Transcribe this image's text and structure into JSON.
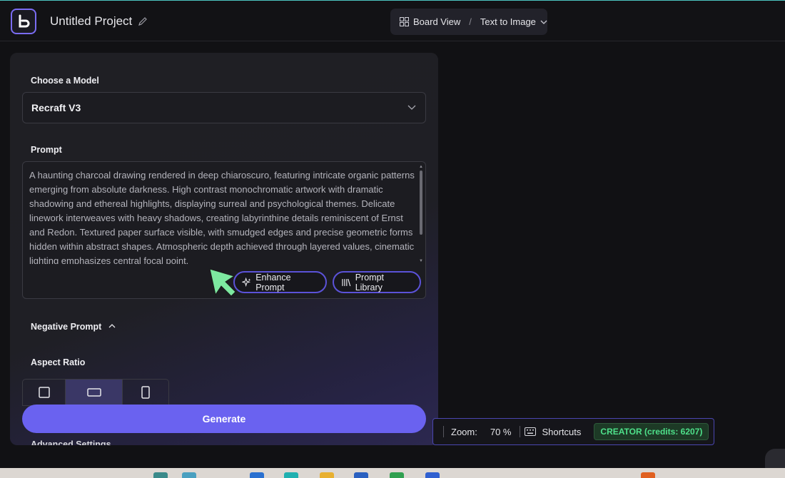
{
  "header": {
    "project_title": "Untitled Project",
    "view_mode": "Board View",
    "separator": "/",
    "tool": "Text to Image"
  },
  "panel": {
    "model_label": "Choose a Model",
    "model_value": "Recraft V3",
    "prompt_label": "Prompt",
    "prompt_text": "A haunting charcoal drawing rendered in deep chiaroscuro, featuring intricate organic patterns emerging from absolute darkness. High contrast monochromatic artwork with dramatic shadowing and ethereal highlights, displaying surreal and psychological themes. Delicate linework interweaves with heavy shadows, creating labyrinthine details reminiscent of Ernst and Redon. Textured paper surface visible, with smudged edges and precise geometric forms hidden within abstract shapes. Atmospheric depth achieved through layered values, cinematic lighting emphasizes central focal point.",
    "enhance_label": "Enhance Prompt",
    "library_label": "Prompt Library",
    "negative_label": "Negative Prompt",
    "aspect_label": "Aspect Ratio",
    "aspect_options": [
      "square",
      "landscape",
      "portrait"
    ],
    "aspect_selected": "landscape",
    "generate_label": "Generate",
    "advanced_label": "Advanced Settings"
  },
  "status": {
    "zoom_label": "Zoom:",
    "zoom_value": "70 %",
    "shortcuts_label": "Shortcuts",
    "credits": "CREATOR (credits: 6207)"
  },
  "colors": {
    "accent": "#6a62f0",
    "credits_green": "#4ee08a",
    "cursor_green": "#7de8a0"
  }
}
